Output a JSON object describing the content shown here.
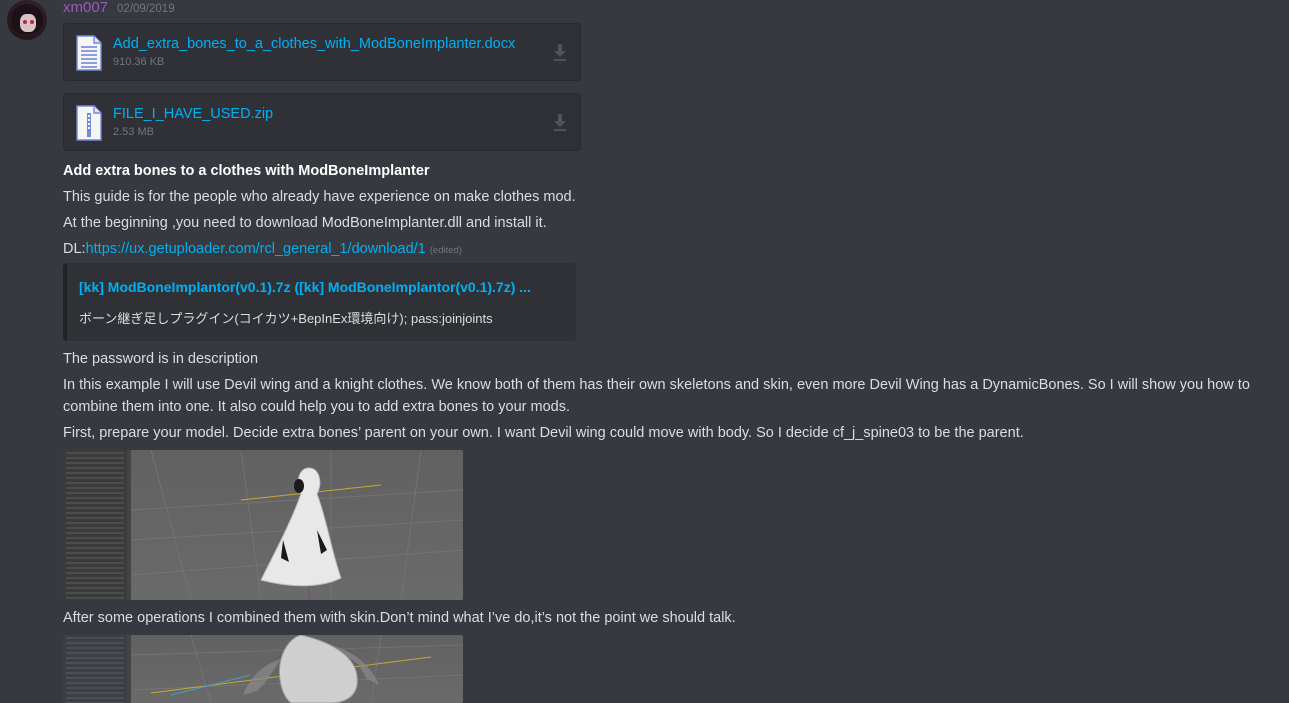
{
  "message": {
    "username": "xm007",
    "timestamp": "02/09/2019",
    "username_color": "#9b59b6"
  },
  "attachments": [
    {
      "name": "Add_extra_bones_to_a_clothes_with_ModBoneImplanter.docx",
      "size": "910.36 KB",
      "icon": "document-file-icon"
    },
    {
      "name": "FILE_I_HAVE_USED.zip",
      "size": "2.53 MB",
      "icon": "archive-file-icon"
    }
  ],
  "content": {
    "heading": "Add extra bones to a clothes with ModBoneImplanter",
    "line1": "This guide is for the people who already have experience on make clothes mod.",
    "line2": "At the beginning ,you need to download ModBoneImplanter.dll and install it.",
    "dl_prefix": "DL:",
    "dl_link": "https://ux.getuploader.com/rcl_general_1/download/1",
    "edited_label": "(edited)",
    "password_line": "The password is in description",
    "example_para": "In this example I will use Devil wing and a knight clothes. We know both of them has their own skeletons and skin, even more Devil Wing has a DynamicBones. So I will show you how to combine them into one. It also could help you to add extra bones to your mods.",
    "first_line": "First, prepare your model. Decide extra bones’ parent on your own. I want Devil wing could move with body. So I decide cf_j_spine03 to be the parent.",
    "after_line": "After some operations I combined them with skin.Don’t mind what I’ve do,it’s not the point we should talk."
  },
  "embed": {
    "title": "[kk] ModBoneImplantor(v0.1).7z ([kk] ModBoneImplantor(v0.1).7z) ...",
    "description": "ボーン継ぎ足しプラグイン(コイカツ+BepInEx環境向け); pass:joinjoints"
  },
  "colors": {
    "background": "#36393f",
    "link": "#00b0f4",
    "attachment_bg": "#2f3136",
    "muted": "#72767d"
  }
}
